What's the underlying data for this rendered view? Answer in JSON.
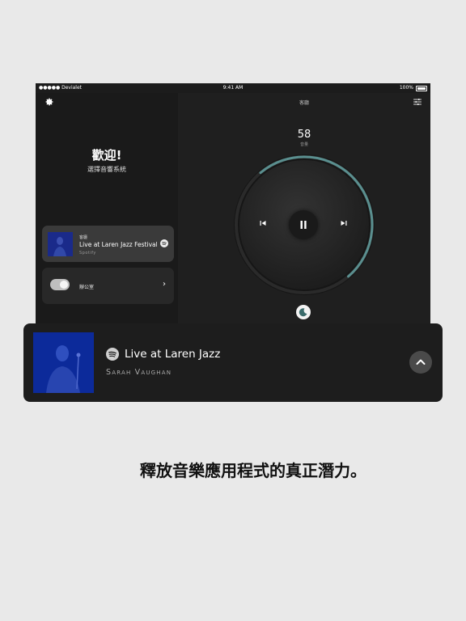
{
  "status_bar": {
    "carrier": "●●●●● Devialet",
    "time": "9:41 AM",
    "battery": "100%"
  },
  "header": {
    "room_title": "客廳"
  },
  "welcome": {
    "title": "歡迎!",
    "subtitle": "選擇音響系統"
  },
  "now_playing_card": {
    "room": "客廳",
    "track": "Live at Laren Jazz Festival",
    "source": "Spotify"
  },
  "room_card": {
    "label": "辦公室"
  },
  "volume": {
    "value": "58",
    "label": "音量",
    "level": 0.58
  },
  "player_bar": {
    "track": "Live at Laren Jazz",
    "artist": "Sarah Vaughan"
  },
  "tagline": "釋放音樂應用程式的真正潛力。",
  "colors": {
    "accent_teal": "#5a8f8f",
    "album_blue": "#0c2a9a",
    "background": "#e9e9e9"
  },
  "icons": [
    "gear-icon",
    "equalizer-icon",
    "spotify-icon",
    "previous-icon",
    "pause-icon",
    "next-icon",
    "moon-icon",
    "chevron-right-icon",
    "chevron-up-icon",
    "wifi-icon",
    "battery-icon"
  ]
}
